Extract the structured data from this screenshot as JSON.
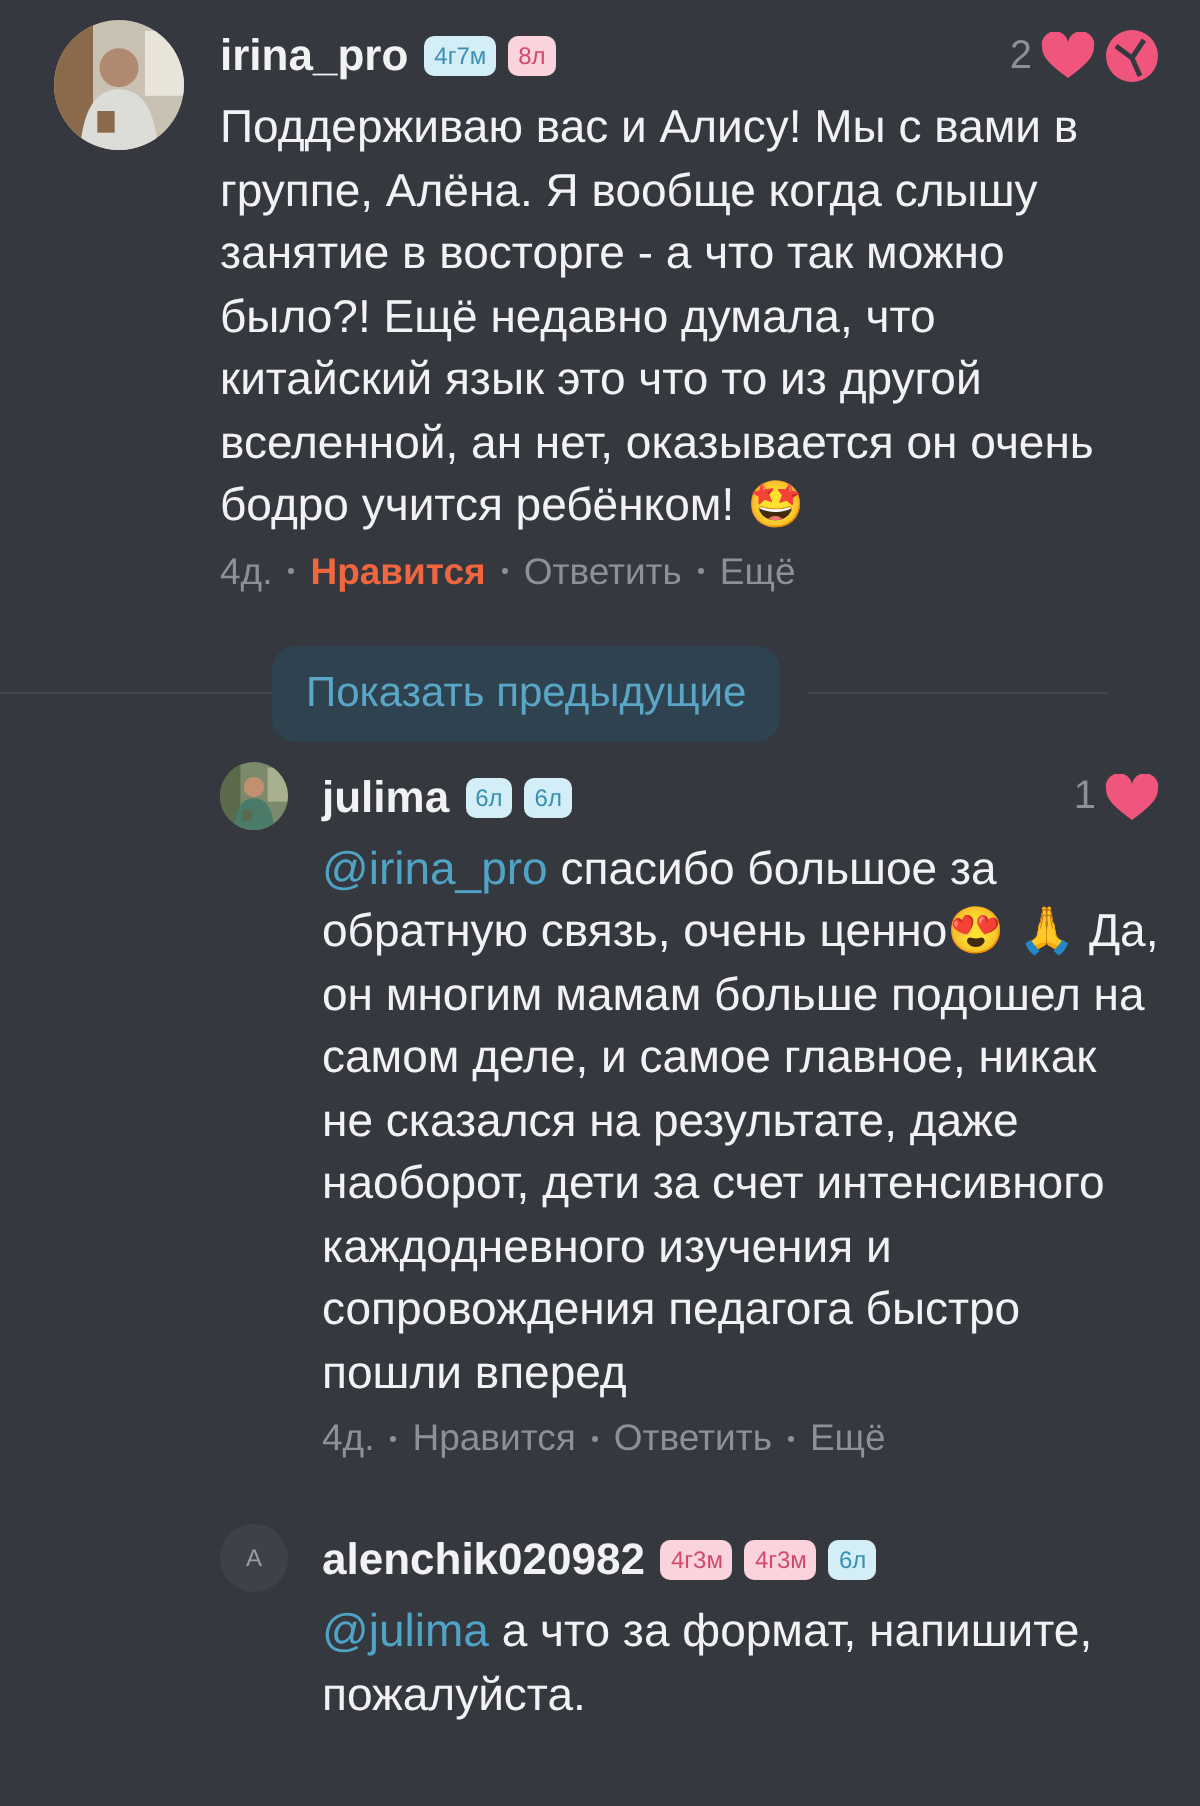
{
  "comments": [
    {
      "kind": "top",
      "avatar": {
        "kind": "picture"
      },
      "author": "irina_pro",
      "badges": [
        {
          "text": "4г7м",
          "color": "#d3eef7"
        },
        {
          "text": "8л",
          "color": "#fad3dc"
        }
      ],
      "likes": "2",
      "gift": true,
      "text": "Поддерживаю вас и Алису! Мы с вами в группе, Алёна. Я вообще когда слышу занятие в восторге - а что так можно было?! Ещё недавно думала, что китайский язык это что то из другой вселенной, ан нет, оказывается он очень бодро учится ребёнком! 🤩",
      "time": "4д.",
      "actions": [
        {
          "label": "Нравится",
          "selected": true
        },
        {
          "label": "Ответить",
          "selected": false
        },
        {
          "label": "Ещё",
          "selected": false
        }
      ]
    },
    {
      "kind": "more",
      "label": "Показать предыдущие"
    },
    {
      "kind": "reply",
      "avatar": {
        "kind": "picture"
      },
      "author": "julima",
      "badges": [
        {
          "text": "6л",
          "color": "#d3eef7"
        },
        {
          "text": "6л",
          "color": "#d3eef7"
        }
      ],
      "likes": "1",
      "gift": false,
      "mention": "@irina_pro",
      "text": "спасибо большое за обратную связь, очень ценно😍 🙏 Да, он многим мамам больше подошел на самом деле, и самое главное, никак не сказался на результате, даже наоборот, дети за счет интенсивного каждодневного изучения и сопровождения педагога быстро пошли вперед",
      "time": "4д.",
      "actions": [
        {
          "label": "Нравится",
          "selected": false
        },
        {
          "label": "Ответить",
          "selected": false
        },
        {
          "label": "Ещё",
          "selected": false
        }
      ]
    },
    {
      "kind": "reply",
      "avatar": {
        "kind": "letter",
        "letter": "А"
      },
      "author": "alenchik020982",
      "badges": [
        {
          "text": "4г3м",
          "color": "#fad3dc"
        },
        {
          "text": "4г3м",
          "color": "#fad3dc"
        },
        {
          "text": "6л",
          "color": "#d3eef7"
        }
      ],
      "mention": "@julima",
      "text": "а что за формат, напишите, пожалуйста."
    }
  ]
}
